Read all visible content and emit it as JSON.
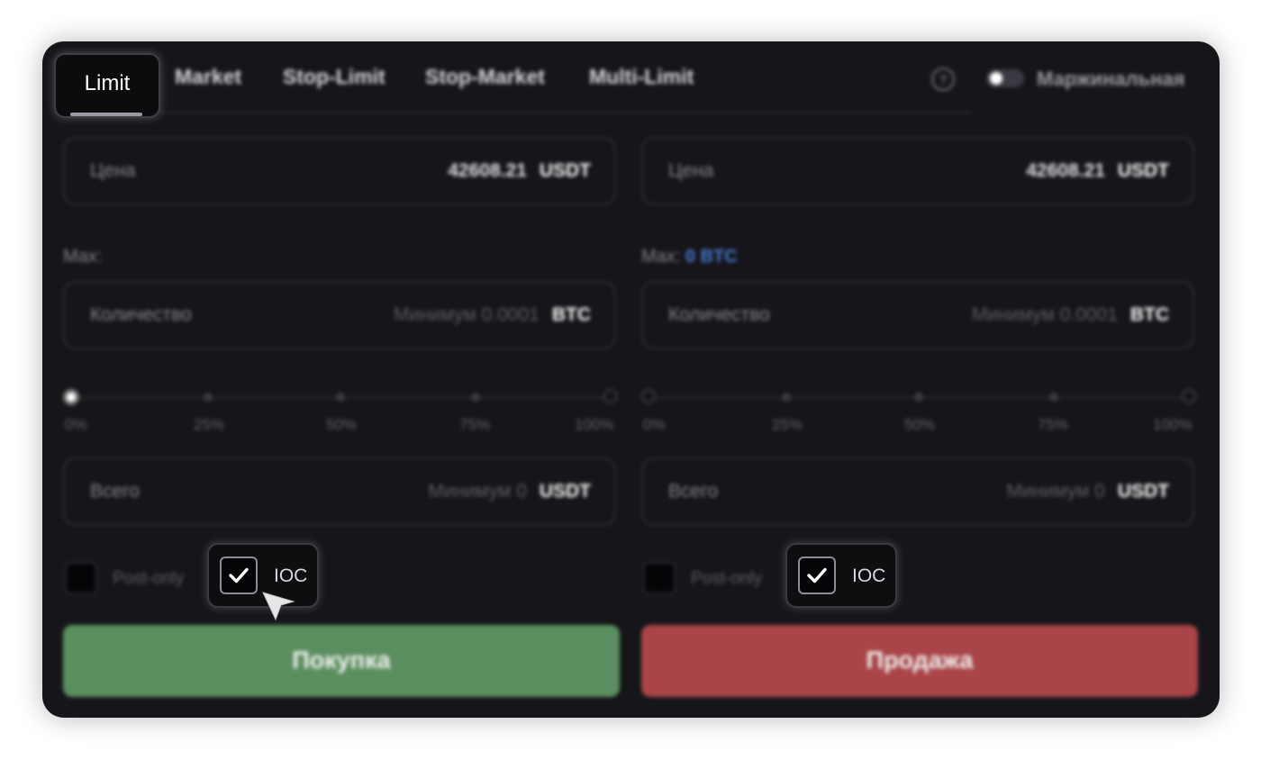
{
  "tabs": {
    "active": "Limit",
    "items": [
      "Market",
      "Stop-Limit",
      "Stop-Market",
      "Multi-Limit"
    ],
    "help_icon": "question-circle-icon",
    "margin_toggle_label": "Маржинальная",
    "margin_toggle_on": false
  },
  "buy": {
    "price_label": "Цена",
    "price_value": "42608.21",
    "price_unit": "USDT",
    "max_label": "Max:",
    "max_value": "",
    "qty_label": "Количество",
    "qty_hint": "Минимум 0.0001",
    "qty_unit": "BTC",
    "slider_ticks": [
      "0%",
      "25%",
      "50%",
      "75%",
      "100%"
    ],
    "slider_value_percent": 0,
    "total_label": "Всего",
    "total_hint": "Минимум 0",
    "total_unit": "USDT",
    "postonly_label": "Post-only",
    "postonly_checked": false,
    "ioc_label": "IOC",
    "ioc_checked": true,
    "button_label": "Покупка"
  },
  "sell": {
    "price_label": "Цена",
    "price_value": "42608.21",
    "price_unit": "USDT",
    "max_label": "Max:",
    "max_value": "0 BTC",
    "qty_label": "Количество",
    "qty_hint": "Минимум 0.0001",
    "qty_unit": "BTC",
    "slider_ticks": [
      "0%",
      "25%",
      "50%",
      "75%",
      "100%"
    ],
    "slider_value_percent": 0,
    "total_label": "Всего",
    "total_hint": "Минимум 0",
    "total_unit": "USDT",
    "postonly_label": "Post-only",
    "postonly_checked": false,
    "ioc_label": "IOC",
    "ioc_checked": true,
    "button_label": "Продажа"
  },
  "colors": {
    "buy": "#5b8e5f",
    "sell": "#a94548",
    "accent_blue": "#4a7bd8",
    "panel_bg": "#16161a"
  }
}
